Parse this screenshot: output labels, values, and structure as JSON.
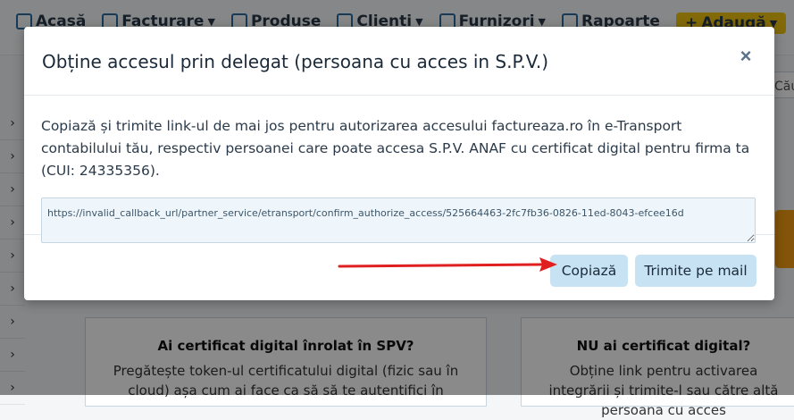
{
  "nav": {
    "items": [
      {
        "label": "Acasă",
        "icon": "home-icon"
      },
      {
        "label": "Facturare",
        "icon": "invoice-icon",
        "dropdown": true
      },
      {
        "label": "Produse",
        "icon": "box-icon"
      },
      {
        "label": "Clienți",
        "icon": "users-icon",
        "dropdown": true
      },
      {
        "label": "Furnizori",
        "icon": "supplier-icon",
        "dropdown": true
      },
      {
        "label": "Rapoarte",
        "icon": "report-icon"
      },
      {
        "label": "Adaugă",
        "icon": "plus-icon",
        "dropdown": true
      }
    ]
  },
  "right_snippet": "Cău",
  "cards": [
    {
      "title": "Ai certificat digital înrolat în SPV?",
      "text": "Pregătește token-ul certificatului digital (fizic sau în cloud) așa cum ai face ca să să te autentifici în"
    },
    {
      "title": "NU ai certificat digital?",
      "text": "Obține link pentru activarea integrării și trimite-l sau către altă persoana cu acces"
    }
  ],
  "modal": {
    "title": "Obține accesul prin delegat (persoana cu acces in S.P.V.)",
    "close_symbol": "×",
    "description": "Copiază și trimite link-ul de mai jos pentru autorizarea accesului factureaza.ro în e-Transport contabilului tău, respectiv persoanei care poate accesa S.P.V. ANAF cu certificat digital pentru firma ta (CUI: 24335356).",
    "link": "https://invalid_callback_url/partner_service/etransport/confirm_authorize_access/525664463-2fc7fb36-0826-11ed-8043-efcee16d",
    "buttons": {
      "copy": "Copiază",
      "mail": "Trimite pe mail"
    }
  },
  "colors": {
    "button_bg": "#c7e3f3",
    "arrow": "#e02020",
    "add_button": "#f1c40f"
  }
}
